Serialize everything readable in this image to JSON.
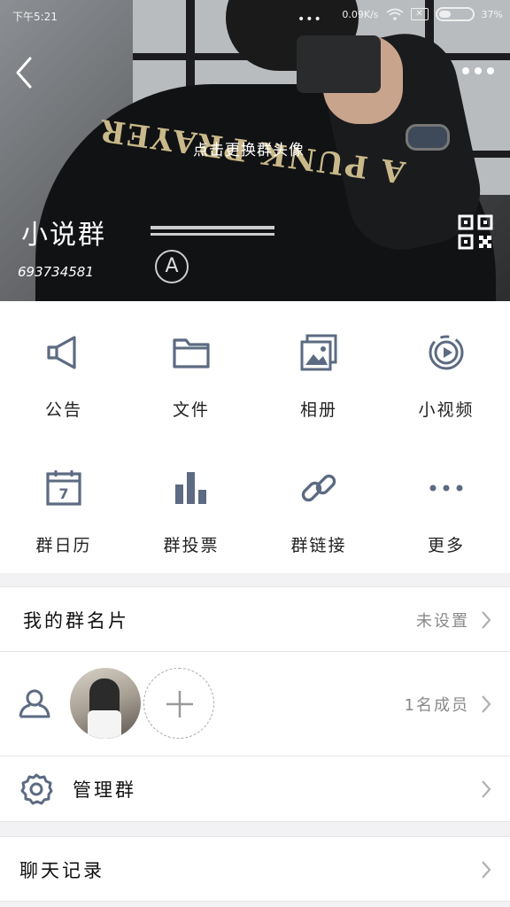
{
  "status_bar": {
    "time": "下午5:21",
    "network_speed": "0.09K/s",
    "battery_percent": "37%",
    "battery_level": 0.37,
    "sim_label": "✕"
  },
  "header": {
    "change_avatar_hint": "点击更换群头像",
    "group_name": "小说群",
    "group_id": "693734581",
    "shirt_print": "A PUNK PRAYER"
  },
  "functions": [
    {
      "label": "公告",
      "icon": "megaphone-icon"
    },
    {
      "label": "文件",
      "icon": "folder-icon"
    },
    {
      "label": "相册",
      "icon": "album-icon"
    },
    {
      "label": "小视频",
      "icon": "video-icon"
    },
    {
      "label": "群日历",
      "icon": "calendar-icon"
    },
    {
      "label": "群投票",
      "icon": "vote-chart-icon"
    },
    {
      "label": "群链接",
      "icon": "link-icon"
    },
    {
      "label": "更多",
      "icon": "more-dots-icon"
    }
  ],
  "calendar_day": "7",
  "rows": {
    "card": {
      "title": "我的群名片",
      "value": "未设置"
    },
    "members": {
      "count_label": "1名成员"
    },
    "manage": {
      "title": "管理群"
    },
    "history": {
      "title": "聊天记录"
    }
  },
  "colors": {
    "icon": "#5c6b82",
    "background": "#f2f2f4"
  }
}
